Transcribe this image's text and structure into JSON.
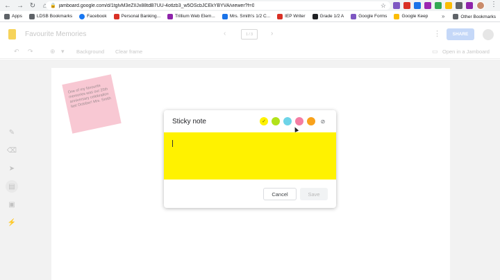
{
  "browser": {
    "url": "jamboard.google.com/d/1tglvM3eZIIJx88tdB7UU-4otlzb3_w5OScbJCEkYBYVA/viewer?f=0",
    "bookmarks": [
      {
        "label": "Apps",
        "color": "#5f6368"
      },
      {
        "label": "LDSB Bookmarks",
        "color": "#5f6368"
      },
      {
        "label": "Facebook",
        "color": "#1877f2"
      },
      {
        "label": "Personal Banking...",
        "color": "#d93025"
      },
      {
        "label": "Trillium Web Elem...",
        "color": "#8e24aa"
      },
      {
        "label": "Mrs. Smith's 1/2 C...",
        "color": "#1a73e8"
      },
      {
        "label": "IEP Writer",
        "color": "#d93025"
      },
      {
        "label": "Grade 1/2 A",
        "color": "#202124"
      },
      {
        "label": "Google Forms",
        "color": "#7e57c2"
      },
      {
        "label": "Google Keep",
        "color": "#fbbc04"
      }
    ],
    "more_chevron": "»",
    "other_bookmarks": "Other Bookmarks"
  },
  "app": {
    "title": "Favourite Memories",
    "frame_indicator": "1 / 3",
    "share_label": "SHARE"
  },
  "toolbar": {
    "background_label": "Background",
    "clear_frame_label": "Clear frame",
    "open_label": "Open in a Jamboard"
  },
  "canvas": {
    "sticky_text": "One of my favourite memories was our 25th anniversary celebration last October! Mrs. Smith"
  },
  "dialog": {
    "title": "Sticky note",
    "colors": [
      "#fff200",
      "#b2e21a",
      "#6dd4e8",
      "#f47da3",
      "#f9a21b"
    ],
    "selected_color_index": 0,
    "note_text": "",
    "cancel_label": "Cancel",
    "save_label": "Save"
  }
}
